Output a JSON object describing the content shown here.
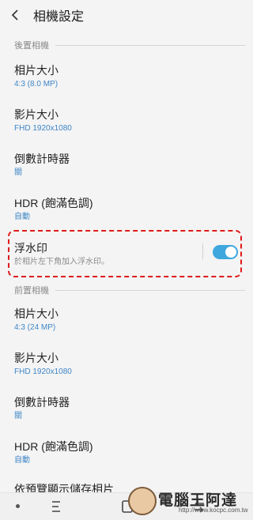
{
  "app": {
    "title": "相機設定"
  },
  "sections": {
    "rear": "後置相機",
    "front": "前置相機"
  },
  "rear": {
    "photo_size": {
      "label": "相片大小",
      "value": "4:3 (8.0 MP)"
    },
    "video_size": {
      "label": "影片大小",
      "value": "FHD 1920x1080"
    },
    "timer": {
      "label": "倒數計時器",
      "value": "關"
    },
    "hdr": {
      "label": "HDR (飽滿色調)",
      "value": "自動"
    },
    "watermark": {
      "label": "浮水印",
      "desc": "於相片左下角加入浮水印。",
      "enabled": true
    }
  },
  "front": {
    "photo_size": {
      "label": "相片大小",
      "value": "4:3 (24 MP)"
    },
    "video_size": {
      "label": "影片大小",
      "value": "FHD 1920x1080"
    },
    "timer": {
      "label": "倒數計時器",
      "value": "關"
    },
    "hdr": {
      "label": "HDR (飽滿色調)",
      "value": "自動"
    },
    "next": {
      "label": "依預覽顯示儲存相片"
    }
  },
  "overlay": {
    "brand": "電腦王阿達",
    "url": "http://www.kocpc.com.tw"
  },
  "colors": {
    "accent": "#3fa7dd",
    "value_text": "#3f86c7",
    "highlight": "#e01a1a"
  }
}
